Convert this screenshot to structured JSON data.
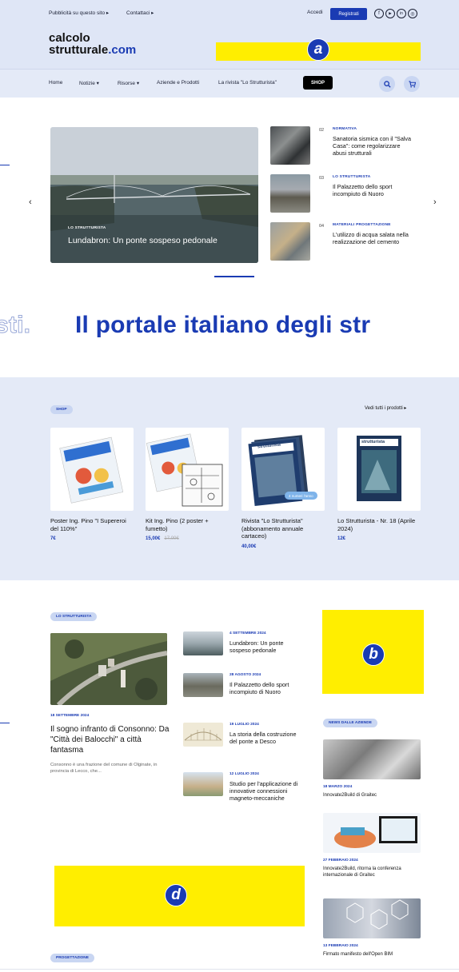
{
  "topbar": {
    "advertise": "Pubblicità su questo sito ▸",
    "contacts": "Contattaci ▸",
    "login": "Accedi",
    "register": "Registrati",
    "social": [
      "f",
      "▶",
      "in",
      "◎"
    ]
  },
  "logo": {
    "line1": "calcolo",
    "line2": "strutturale",
    "suffix": ".com"
  },
  "markers": {
    "a": "a",
    "b": "b",
    "d": "d"
  },
  "nav": {
    "items": [
      "Home",
      "Notizie ▾",
      "Risorse ▾",
      "Aziende e Prodotti",
      "La rivista \"Lo Strutturista\""
    ],
    "shop": "SHOP",
    "search_icon": "search-icon",
    "cart_icon": "cart-icon"
  },
  "hero": {
    "tag": "LO STRUTTURISTA",
    "title": "Lundabron: Un ponte sospeso pedonale",
    "prev": "‹",
    "next": "›",
    "side": [
      {
        "num": "02",
        "tag": "NORMATIVA",
        "title": "Sanatoria sismica con il \"Salva Casa\": come regolarizzare abusi strutturali"
      },
      {
        "num": "03",
        "tag": "LO STRUTTURISTA",
        "title": "Il Palazzetto dello sport incompiuto di Nuoro"
      },
      {
        "num": "04",
        "tag": "MATERIALI PROGETTAZIONE",
        "title": "L'utilizzo di acqua salata nella realizzazione del cemento"
      }
    ]
  },
  "banner": {
    "ghost": "sti.",
    "text": "Il portale italiano degli str"
  },
  "shop": {
    "label": "SHOP",
    "see_all": "Vedi tutti i prodotti ▸",
    "products": [
      {
        "title": "Poster Ing. Pino \"I Supereroi del 110%\"",
        "price": "7€",
        "old": ""
      },
      {
        "title": "Kit Ing. Pino (2 poster + fumetto)",
        "price": "15,00€",
        "old": "17,00€"
      },
      {
        "title": "Rivista \"Lo Strutturista\" (abbonamento annuale cartaceo)",
        "price": "40,00€",
        "old": ""
      },
      {
        "title": "Lo Strutturista - Nr. 18 (Aprile 2024)",
        "price": "12€",
        "old": ""
      }
    ],
    "badge": "4 numeri l'anno",
    "mag_name": "strutturista"
  },
  "strutturista": {
    "label": "LO STRUTTURISTA",
    "main": {
      "date": "18 SETTEMBRE 2024",
      "title": "Il sogno infranto di Consonno: Da \"Città dei Balocchi\" a città fantasma",
      "excerpt": "Consonno è una frazione del comune di Olginate, in provincia di Lecco, che..."
    },
    "list": [
      {
        "date": "4 SETTEMBRE 2024",
        "title": "Lundabron: Un ponte sospeso pedonale"
      },
      {
        "date": "28 AGOSTO 2024",
        "title": "Il Palazzetto dello sport incompiuto di Nuoro"
      },
      {
        "date": "19 LUGLIO 2024",
        "title": "La storia della costruzione del ponte a Desco"
      },
      {
        "date": "12 LUGLIO 2024",
        "title": "Studio per l'applicazione di innovative connessioni magneto-meccaniche"
      }
    ]
  },
  "news": {
    "label": "NEWS DALLE AZIENDE",
    "items": [
      {
        "date": "18 MARZO 2024",
        "title": "Innovate2Build di Graitec"
      },
      {
        "date": "27 FEBBRAIO 2024",
        "title": "Innovate2Build, ritorna la conferenza internazionale di Graitec"
      },
      {
        "date": "13 FEBBRAIO 2024",
        "title": "Firmato manifesto dell'Open BIM"
      }
    ]
  },
  "progettazione": {
    "label": "PROGETTAZIONE"
  }
}
